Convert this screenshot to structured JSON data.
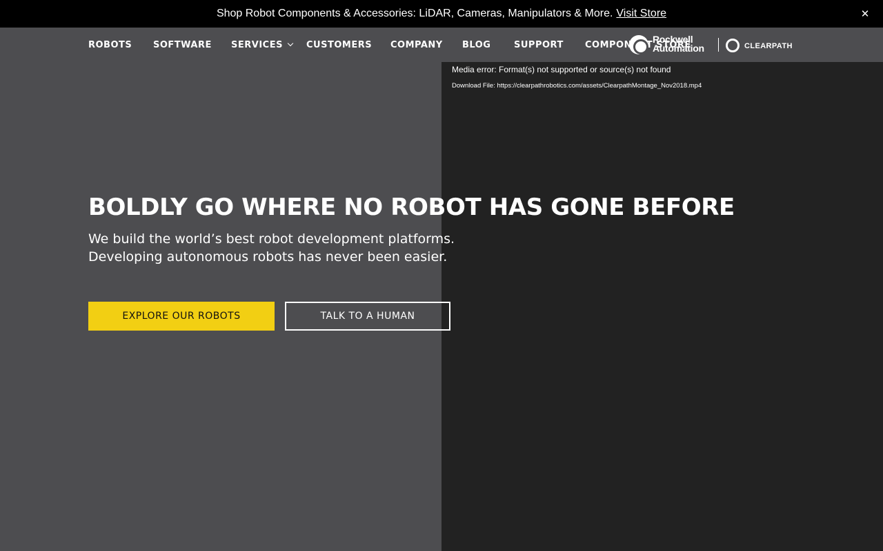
{
  "promo": {
    "text": "Shop Robot Components & Accessories: LiDAR, Cameras, Manipulators & More.",
    "link_label": "Visit Store",
    "close_glyph": "✕"
  },
  "nav": {
    "items": [
      {
        "label": "ROBOTS"
      },
      {
        "label": "SOFTWARE"
      },
      {
        "label": "SERVICES",
        "has_dropdown": true
      },
      {
        "label": "CUSTOMERS"
      },
      {
        "label": "COMPANY"
      },
      {
        "label": "BLOG"
      },
      {
        "label": "SUPPORT"
      },
      {
        "label": "COMPONENT STORE"
      }
    ]
  },
  "logos": {
    "rockwell_line1": "Rockwell",
    "rockwell_line2": "Automation",
    "clearpath": "CLEARPATH"
  },
  "video": {
    "error_text": "Media error: Format(s) not supported or source(s) not found",
    "download_text": "Download File: https://clearpathrobotics.com/assets/ClearpathMontage_Nov2018.mp4"
  },
  "hero": {
    "title": "BOLDLY GO WHERE NO ROBOT HAS GONE BEFORE",
    "subtitle_line1": "We build the world’s best robot development platforms.",
    "subtitle_line2": "Developing autonomous robots has never been easier.",
    "primary_button": "EXPLORE OUR ROBOTS",
    "secondary_button": "TALK TO A HUMAN"
  },
  "colors": {
    "accent": "#f2cf13",
    "background": "#4d4d50",
    "video_panel": "#222222",
    "promo_bar": "#000000"
  }
}
